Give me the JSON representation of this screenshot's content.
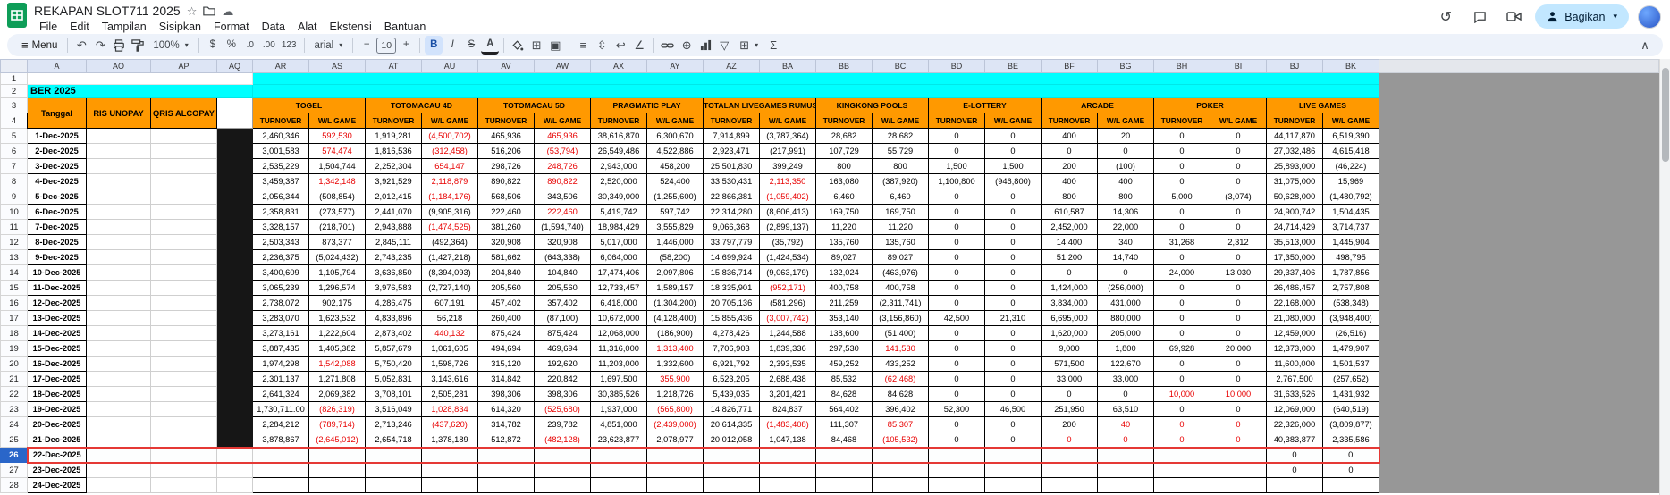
{
  "titlebar": {
    "title": "REKAPAN SLOT711 2025",
    "menus": [
      "File",
      "Edit",
      "Tampilan",
      "Sisipkan",
      "Format",
      "Data",
      "Alat",
      "Ekstensi",
      "Bantuan"
    ],
    "share_label": "Bagikan"
  },
  "toolbar": {
    "menu_label": "Menu",
    "zoom": "100%",
    "font_name": "arial",
    "font_size": "10",
    "icons": {
      "undo": "↶",
      "redo": "↷",
      "currency": "$",
      "percent": "%",
      "dec_decimal": ".0",
      "inc_decimal": ".00",
      "more_formats": "123",
      "minus": "−",
      "plus": "+",
      "bold": "B",
      "italic": "I",
      "strikethrough": "S",
      "text_color": "A",
      "borders": "⊞",
      "merge": "▣",
      "h_align": "≡",
      "v_align": "⇳",
      "wrap": "↩",
      "rotate": "∠",
      "insert": "⊕",
      "filter": "▽",
      "table": "⊞",
      "functions": "Σ",
      "collapse": "∧",
      "chevron": "▾",
      "star": "☆",
      "cloud": "☁",
      "history": "↺"
    }
  },
  "colors": {
    "header_orange": "#ff9900",
    "banner_cyan": "#00ffff",
    "negative_red": "#e80000",
    "selection_red": "#e53935",
    "share_button_bg": "#c2e7ff"
  },
  "sheet": {
    "column_letters": [
      "A",
      "AO",
      "AP",
      "AQ",
      "AR",
      "AS",
      "AT",
      "AU",
      "AV",
      "AW",
      "AX",
      "AY",
      "AZ",
      "BA",
      "BB",
      "BC",
      "BD",
      "BE",
      "BF",
      "BG",
      "BH",
      "BI",
      "BJ",
      "BK"
    ],
    "banner_text": "BER 2025",
    "selected_row_number": 26,
    "header": {
      "date_label": "Tanggal",
      "pay_col_1": "RIS UNOPAY",
      "pay_col_2": "QRIS ALCOPAY",
      "turnover_label": "TURNOVER",
      "wl_label": "W/L GAME",
      "groups": [
        "TOGEL",
        "TOTOMACAU 4D",
        "TOTOMACAU 5D",
        "PRAGMATIC PLAY",
        "TOTALAN LIVEGAMES RUMUS",
        "KINGKONG POOLS",
        "E-LOTTERY",
        "ARCADE",
        "POKER",
        "LIVE GAMES"
      ]
    },
    "rows": [
      {
        "date": "1-Dec-2025",
        "cells": [
          "2,460,346",
          {
            "v": "592,530",
            "red": true
          },
          "1,919,281",
          {
            "v": "(4,500,702)",
            "red": true
          },
          "465,936",
          {
            "v": "465,936",
            "red": true
          },
          "38,616,870",
          "6,300,670",
          "7,914,899",
          "(3,787,364)",
          "28,682",
          "28,682",
          "0",
          "0",
          "400",
          "20",
          "0",
          "0",
          "44,117,870",
          "6,519,390"
        ]
      },
      {
        "date": "2-Dec-2025",
        "cells": [
          "3,001,583",
          {
            "v": "574,474",
            "red": true
          },
          "1,816,536",
          {
            "v": "(312,458)",
            "red": true
          },
          "516,206",
          {
            "v": "(53,794)",
            "red": true
          },
          "26,549,486",
          "4,522,886",
          "2,923,471",
          "(217,991)",
          "107,729",
          "55,729",
          "0",
          "0",
          "0",
          "0",
          "0",
          "0",
          "27,032,486",
          "4,615,418"
        ]
      },
      {
        "date": "3-Dec-2025",
        "cells": [
          "2,535,229",
          "1,504,744",
          "2,252,304",
          {
            "v": "654,147",
            "red": true
          },
          "298,726",
          {
            "v": "248,726",
            "red": true
          },
          "2,943,000",
          "458,200",
          "25,501,830",
          "399,249",
          "800",
          "800",
          "1,500",
          "1,500",
          "200",
          "(100)",
          "0",
          "0",
          "25,893,000",
          "(46,224)"
        ]
      },
      {
        "date": "4-Dec-2025",
        "cells": [
          "3,459,387",
          {
            "v": "1,342,148",
            "red": true
          },
          "3,921,529",
          {
            "v": "2,118,879",
            "red": true
          },
          "890,822",
          {
            "v": "890,822",
            "red": true
          },
          "2,520,000",
          "524,400",
          "33,530,431",
          {
            "v": "2,113,350",
            "red": true
          },
          "163,080",
          "(387,920)",
          "1,100,800",
          "(946,800)",
          "400",
          "400",
          "0",
          "0",
          "31,075,000",
          "15,969"
        ]
      },
      {
        "date": "5-Dec-2025",
        "cells": [
          "2,056,344",
          "(508,854)",
          "2,012,415",
          {
            "v": "(1,184,176)",
            "red": true
          },
          "568,506",
          "343,506",
          "30,349,000",
          "(1,255,600)",
          "22,866,381",
          {
            "v": "(1,059,402)",
            "red": true
          },
          "6,460",
          "6,460",
          "0",
          "0",
          "800",
          "800",
          "5,000",
          "(3,074)",
          "50,628,000",
          "(1,480,792)"
        ]
      },
      {
        "date": "6-Dec-2025",
        "cells": [
          "2,358,831",
          "(273,577)",
          "2,441,070",
          "(9,905,316)",
          "222,460",
          {
            "v": "222,460",
            "red": true
          },
          "5,419,742",
          "597,742",
          "22,314,280",
          "(8,606,413)",
          "169,750",
          "169,750",
          "0",
          "0",
          "610,587",
          "14,306",
          "0",
          "0",
          "24,900,742",
          "1,504,435"
        ]
      },
      {
        "date": "7-Dec-2025",
        "cells": [
          "3,328,157",
          "(218,701)",
          "2,943,888",
          {
            "v": "(1,474,525)",
            "red": true
          },
          "381,260",
          "(1,594,740)",
          "18,984,429",
          "3,555,829",
          "9,066,368",
          "(2,899,137)",
          "11,220",
          "11,220",
          "0",
          "0",
          "2,452,000",
          "22,000",
          "0",
          "0",
          "24,714,429",
          "3,714,737"
        ]
      },
      {
        "date": "8-Dec-2025",
        "cells": [
          "2,503,343",
          "873,377",
          "2,845,111",
          "(492,364)",
          "320,908",
          "320,908",
          "5,017,000",
          "1,446,000",
          "33,797,779",
          "(35,792)",
          "135,760",
          "135,760",
          "0",
          "0",
          "14,400",
          "340",
          "31,268",
          "2,312",
          "35,513,000",
          "1,445,904"
        ]
      },
      {
        "date": "9-Dec-2025",
        "cells": [
          "2,236,375",
          "(5,024,432)",
          "2,743,235",
          "(1,427,218)",
          "581,662",
          "(643,338)",
          "6,064,000",
          "(58,200)",
          "14,699,924",
          "(1,424,534)",
          "89,027",
          "89,027",
          "0",
          "0",
          "51,200",
          "14,740",
          "0",
          "0",
          "17,350,000",
          "498,795"
        ]
      },
      {
        "date": "10-Dec-2025",
        "cells": [
          "3,400,609",
          "1,105,794",
          "3,636,850",
          "(8,394,093)",
          "204,840",
          "104,840",
          "17,474,406",
          "2,097,806",
          "15,836,714",
          "(9,063,179)",
          "132,024",
          "(463,976)",
          "0",
          "0",
          "0",
          "0",
          "24,000",
          "13,030",
          "29,337,406",
          "1,787,856"
        ]
      },
      {
        "date": "11-Dec-2025",
        "cells": [
          "3,065,239",
          "1,296,574",
          "3,976,583",
          "(2,727,140)",
          "205,560",
          "205,560",
          "12,733,457",
          "1,589,157",
          "18,335,901",
          {
            "v": "(952,171)",
            "red": true
          },
          "400,758",
          "400,758",
          "0",
          "0",
          "1,424,000",
          "(256,000)",
          "0",
          "0",
          "26,486,457",
          "2,757,808"
        ]
      },
      {
        "date": "12-Dec-2025",
        "cells": [
          "2,738,072",
          "902,175",
          "4,286,475",
          "607,191",
          "457,402",
          "357,402",
          "6,418,000",
          "(1,304,200)",
          "20,705,136",
          "(581,296)",
          "211,259",
          "(2,311,741)",
          "0",
          "0",
          "3,834,000",
          "431,000",
          "0",
          "0",
          "22,168,000",
          "(538,348)"
        ]
      },
      {
        "date": "13-Dec-2025",
        "cells": [
          "3,283,070",
          "1,623,532",
          "4,833,896",
          "56,218",
          "260,400",
          "(87,100)",
          "10,672,000",
          "(4,128,400)",
          "15,855,436",
          {
            "v": "(3,007,742)",
            "red": true
          },
          "353,140",
          "(3,156,860)",
          "42,500",
          "21,310",
          "6,695,000",
          "880,000",
          "0",
          "0",
          "21,080,000",
          "(3,948,400)"
        ]
      },
      {
        "date": "14-Dec-2025",
        "cells": [
          "3,273,161",
          "1,222,604",
          "2,873,402",
          {
            "v": "440,132",
            "red": true
          },
          "875,424",
          "875,424",
          "12,068,000",
          "(186,900)",
          "4,278,426",
          "1,244,588",
          "138,600",
          "(51,400)",
          "0",
          "0",
          "1,620,000",
          "205,000",
          "0",
          "0",
          "12,459,000",
          "(26,516)"
        ]
      },
      {
        "date": "15-Dec-2025",
        "cells": [
          "3,887,435",
          "1,405,382",
          "5,857,679",
          "1,061,605",
          "494,694",
          "469,694",
          "11,316,000",
          {
            "v": "1,313,400",
            "red": true
          },
          "7,706,903",
          "1,839,336",
          "297,530",
          {
            "v": "141,530",
            "red": true
          },
          "0",
          "0",
          "9,000",
          "1,800",
          "69,928",
          "20,000",
          "12,373,000",
          "1,479,907"
        ]
      },
      {
        "date": "16-Dec-2025",
        "cells": [
          "1,974,298",
          {
            "v": "1,542,088",
            "red": true
          },
          "5,750,420",
          "1,598,726",
          "315,120",
          "192,620",
          "11,203,000",
          "1,332,600",
          "6,921,792",
          "2,393,535",
          "459,252",
          "433,252",
          "0",
          "0",
          "571,500",
          "122,670",
          "0",
          "0",
          "11,600,000",
          "1,501,537"
        ]
      },
      {
        "date": "17-Dec-2025",
        "cells": [
          "2,301,137",
          "1,271,808",
          "5,052,831",
          "3,143,616",
          "314,842",
          "220,842",
          "1,697,500",
          {
            "v": "355,900",
            "red": true
          },
          "6,523,205",
          "2,688,438",
          "85,532",
          {
            "v": "(62,468)",
            "red": true
          },
          "0",
          "0",
          "33,000",
          "33,000",
          "0",
          "0",
          "2,767,500",
          "(257,652)"
        ]
      },
      {
        "date": "18-Dec-2025",
        "cells": [
          "2,641,324",
          "2,069,382",
          "3,708,101",
          "2,505,281",
          "398,306",
          "398,306",
          "30,385,526",
          "1,218,726",
          "5,439,035",
          "3,201,421",
          "84,628",
          "84,628",
          "0",
          "0",
          "0",
          "0",
          {
            "v": "10,000",
            "red": true
          },
          {
            "v": "10,000",
            "red": true
          },
          "31,633,526",
          "1,431,932"
        ]
      },
      {
        "date": "19-Dec-2025",
        "cells": [
          "1,730,711.00",
          {
            "v": "(826,319)",
            "red": true
          },
          "3,516,049",
          {
            "v": "1,028,834",
            "red": true
          },
          "614,320",
          {
            "v": "(525,680)",
            "red": true
          },
          "1,937,000",
          {
            "v": "(565,800)",
            "red": true
          },
          "14,826,771",
          "824,837",
          "564,402",
          "396,402",
          "52,300",
          "46,500",
          "251,950",
          "63,510",
          "0",
          "0",
          "12,069,000",
          "(640,519)"
        ]
      },
      {
        "date": "20-Dec-2025",
        "cells": [
          "2,284,212",
          {
            "v": "(789,714)",
            "red": true
          },
          "2,713,246",
          {
            "v": "(437,620)",
            "red": true
          },
          "314,782",
          "239,782",
          "4,851,000",
          {
            "v": "(2,439,000)",
            "red": true
          },
          "20,614,335",
          {
            "v": "(1,483,408)",
            "red": true
          },
          "111,307",
          {
            "v": "85,307",
            "red": true
          },
          "0",
          "0",
          "200",
          {
            "v": "40",
            "red": true
          },
          {
            "v": "0",
            "red": true
          },
          {
            "v": "0",
            "red": true
          },
          "22,326,000",
          "(3,809,877)"
        ]
      },
      {
        "date": "21-Dec-2025",
        "cells": [
          "3,878,867",
          {
            "v": "(2,645,012)",
            "red": true
          },
          "2,654,718",
          "1,378,189",
          "512,872",
          {
            "v": "(482,128)",
            "red": true
          },
          "23,623,877",
          "2,078,977",
          "20,012,058",
          "1,047,138",
          "84,468",
          {
            "v": "(105,532)",
            "red": true
          },
          "0",
          "0",
          {
            "v": "0",
            "red": true
          },
          {
            "v": "0",
            "red": true
          },
          {
            "v": "0",
            "red": true
          },
          {
            "v": "0",
            "red": true
          },
          "40,383,877",
          "2,335,586"
        ]
      },
      {
        "date": "22-Dec-2025",
        "cells": [
          "",
          "",
          "",
          "",
          "",
          "",
          "",
          "",
          "",
          "",
          "",
          "",
          "",
          "",
          "",
          "",
          "",
          "",
          "0",
          "0"
        ]
      },
      {
        "date": "23-Dec-2025",
        "cells": [
          "",
          "",
          "",
          "",
          "",
          "",
          "",
          "",
          "",
          "",
          "",
          "",
          "",
          "",
          "",
          "",
          "",
          "",
          "0",
          "0"
        ]
      },
      {
        "date": "24-Dec-2025",
        "cells": [
          "",
          "",
          "",
          "",
          "",
          "",
          "",
          "",
          "",
          "",
          "",
          "",
          "",
          "",
          "",
          "",
          "",
          "",
          "",
          ""
        ]
      }
    ]
  }
}
